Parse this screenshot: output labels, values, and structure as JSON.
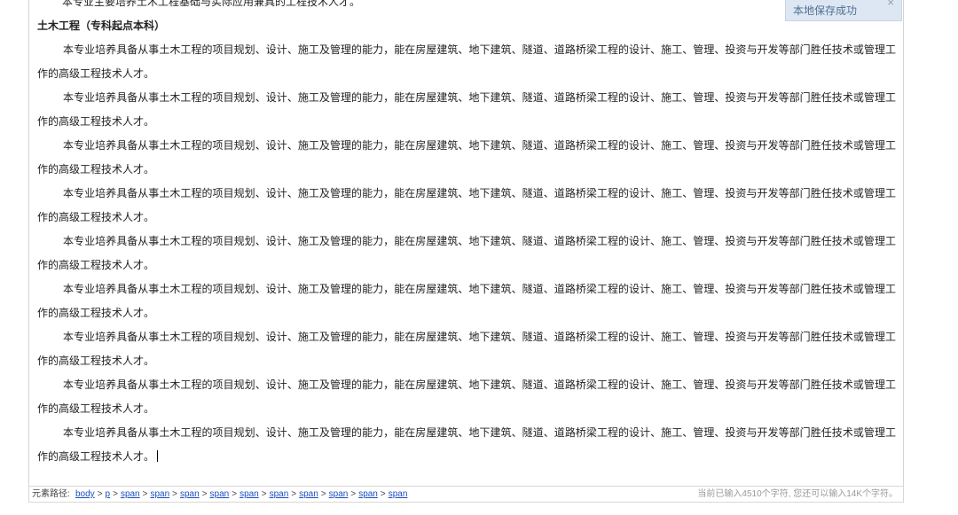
{
  "editor": {
    "cut_off_line": "本专业主要培养土木工程基础与实际应用兼具的工程技术人才。",
    "heading": "土木工程（专科起点本科）",
    "paragraphs": [
      "本专业培养具备从事土木工程的项目规划、设计、施工及管理的能力，能在房屋建筑、地下建筑、隧道、道路桥梁工程的设计、施工、管理、投资与开发等部门胜任技术或管理工作的高级工程技术人才。",
      "本专业培养具备从事土木工程的项目规划、设计、施工及管理的能力，能在房屋建筑、地下建筑、隧道、道路桥梁工程的设计、施工、管理、投资与开发等部门胜任技术或管理工作的高级工程技术人才。",
      "本专业培养具备从事土木工程的项目规划、设计、施工及管理的能力，能在房屋建筑、地下建筑、隧道、道路桥梁工程的设计、施工、管理、投资与开发等部门胜任技术或管理工作的高级工程技术人才。",
      "本专业培养具备从事土木工程的项目规划、设计、施工及管理的能力，能在房屋建筑、地下建筑、隧道、道路桥梁工程的设计、施工、管理、投资与开发等部门胜任技术或管理工作的高级工程技术人才。",
      "本专业培养具备从事土木工程的项目规划、设计、施工及管理的能力，能在房屋建筑、地下建筑、隧道、道路桥梁工程的设计、施工、管理、投资与开发等部门胜任技术或管理工作的高级工程技术人才。",
      "本专业培养具备从事土木工程的项目规划、设计、施工及管理的能力，能在房屋建筑、地下建筑、隧道、道路桥梁工程的设计、施工、管理、投资与开发等部门胜任技术或管理工作的高级工程技术人才。",
      "本专业培养具备从事土木工程的项目规划、设计、施工及管理的能力，能在房屋建筑、地下建筑、隧道、道路桥梁工程的设计、施工、管理、投资与开发等部门胜任技术或管理工作的高级工程技术人才。",
      "本专业培养具备从事土木工程的项目规划、设计、施工及管理的能力，能在房屋建筑、地下建筑、隧道、道路桥梁工程的设计、施工、管理、投资与开发等部门胜任技术或管理工作的高级工程技术人才。",
      "本专业培养具备从事土木工程的项目规划、设计、施工及管理的能力，能在房屋建筑、地下建筑、隧道、道路桥梁工程的设计、施工、管理、投资与开发等部门胜任技术或管理工作的高级工程技术人才。"
    ]
  },
  "toast": {
    "message": "本地保存成功",
    "close_glyph": "×",
    "close_icon": "close-icon"
  },
  "statusbar": {
    "path_label": "元素路径:",
    "path": [
      "body",
      "p",
      "span",
      "span",
      "span",
      "span",
      "span",
      "span",
      "span",
      "span",
      "span",
      "span"
    ],
    "separator": ">",
    "word_count": "当前已输入4510个字符, 您还可以输入14K个字符。"
  },
  "colors": {
    "link": "#1a4dbf",
    "toast_bg": "#dde7f3",
    "toast_text": "#4f6f93",
    "border": "#d4d4d4"
  }
}
